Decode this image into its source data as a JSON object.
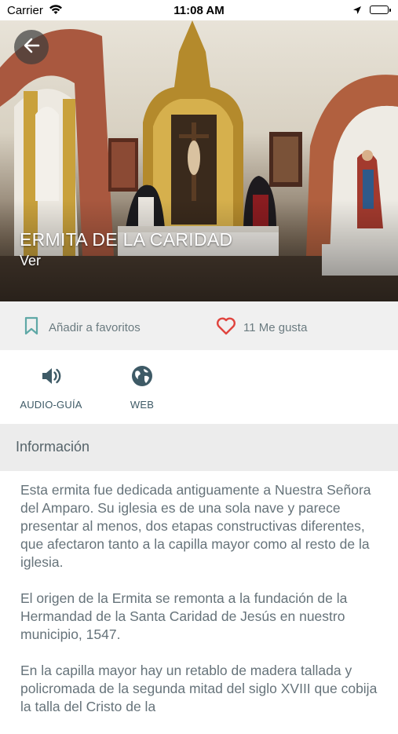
{
  "status_bar": {
    "carrier": "Carrier",
    "time": "11:08 AM"
  },
  "hero": {
    "title": "ERMITA DE LA CARIDAD",
    "subtitle": "Ver"
  },
  "actions": {
    "favorites_label": "Añadir a favoritos",
    "likes_label": "11 Me gusta"
  },
  "tools": [
    {
      "label": "AUDIO-GUÍA",
      "icon": "speaker-icon"
    },
    {
      "label": "WEB",
      "icon": "globe-icon"
    }
  ],
  "section": {
    "title": "Información"
  },
  "body": {
    "paragraphs": [
      "Esta ermita fue dedicada antiguamente a Nuestra Señora del Amparo. Su iglesia es de una sola nave y parece presentar al menos, dos etapas constructivas diferentes, que afectaron tanto a la capilla mayor como al resto de la iglesia.",
      "El origen de la Ermita se remonta a la fundación de la Hermandad de la Santa Caridad de Jesús en nuestro municipio, 1547.",
      "En la capilla mayor hay un retablo de madera tallada y policromada de la segunda mitad del siglo XVIII que cobija la talla del Cristo de la"
    ]
  },
  "colors": {
    "accent_teal": "#5fa8a6",
    "heart_red": "#e0443e",
    "icon_dark": "#3e5a66"
  }
}
